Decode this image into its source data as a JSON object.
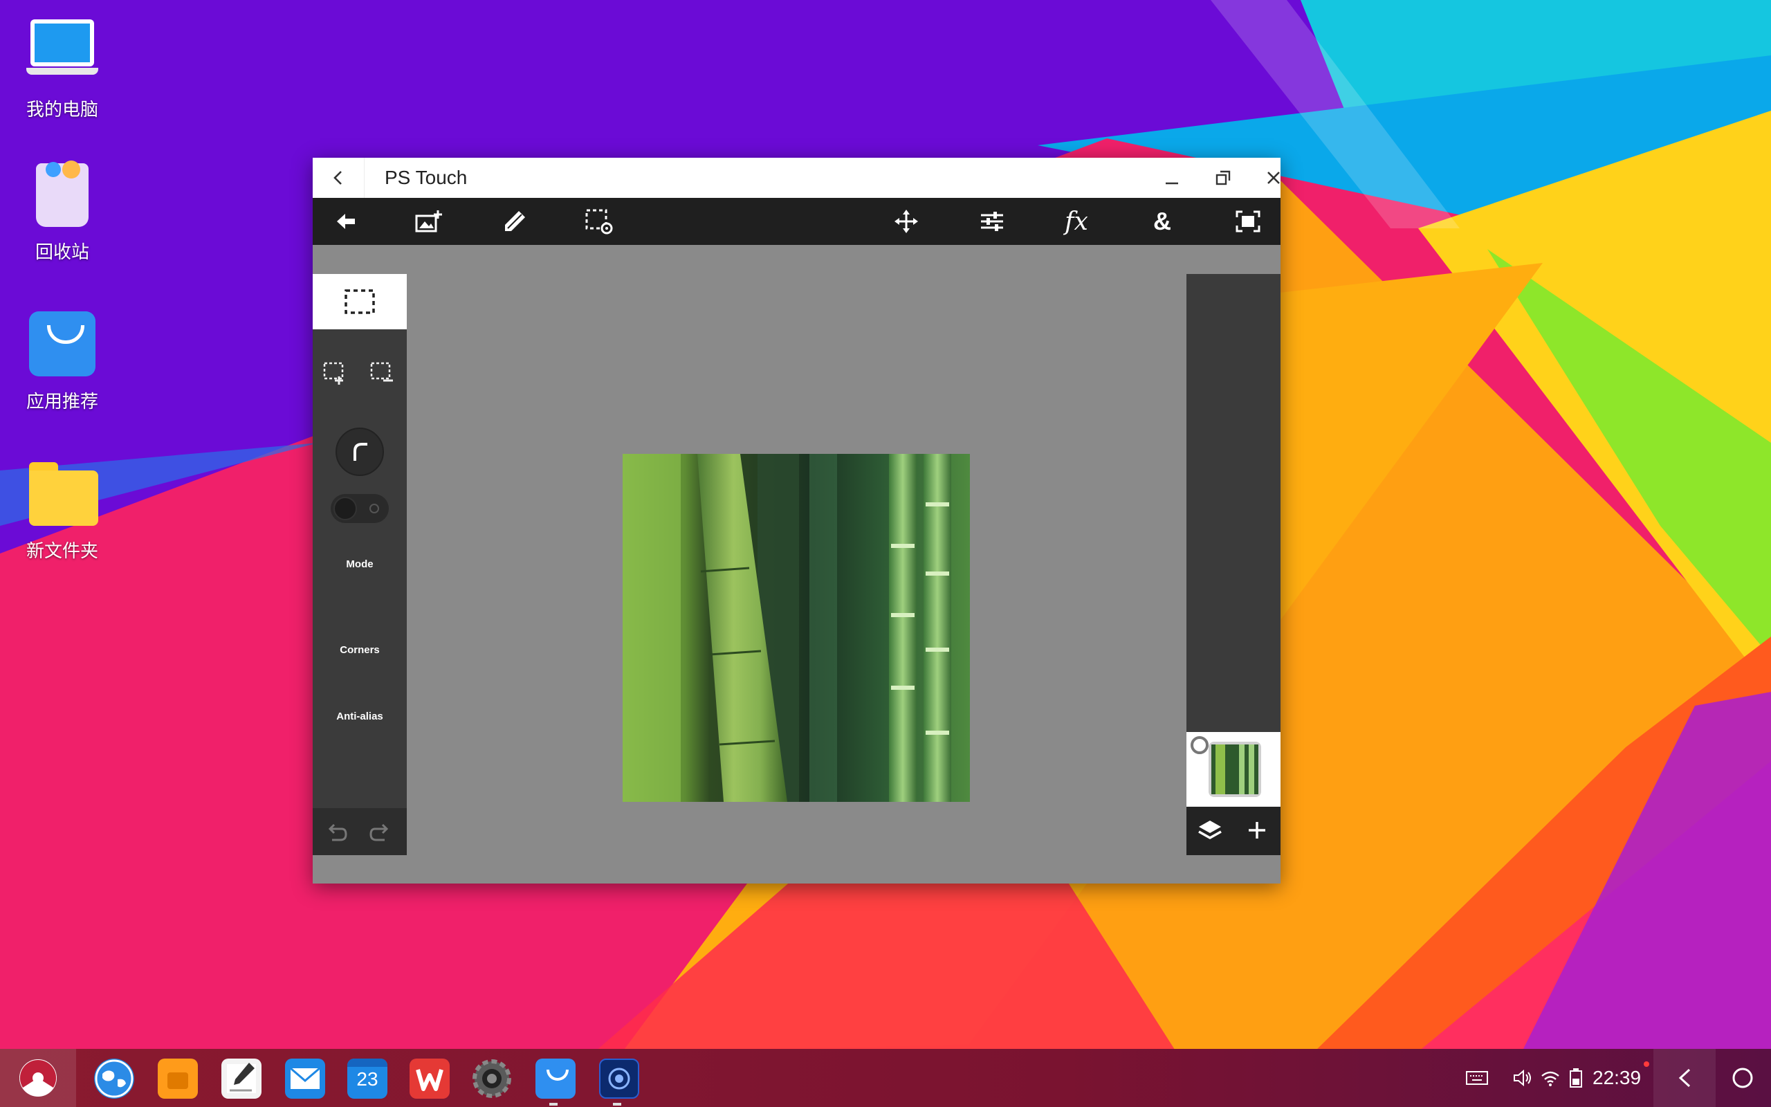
{
  "desktop": {
    "icons": [
      {
        "label": "我的电脑"
      },
      {
        "label": "回收站"
      },
      {
        "label": "应用推荐"
      },
      {
        "label": "新文件夹"
      }
    ]
  },
  "window": {
    "title": "PS Touch",
    "toolbar_icons": [
      "back-arrow-icon",
      "add-image-icon",
      "brush-icon",
      "selection-settings-icon",
      "move-icon",
      "adjustments-icon",
      "fx-icon",
      "ampersand-icon",
      "fit-screen-icon"
    ],
    "fx_label": "fx",
    "amp_label": "&"
  },
  "left_panel": {
    "mode_label": "Mode",
    "corners_label": "Corners",
    "antialias_label": "Anti-alias",
    "antialias_on": false
  },
  "right_panel": {
    "layer_count": 1
  },
  "taskbar": {
    "apps": [
      "browser-icon",
      "files-icon",
      "notes-icon",
      "mail-icon",
      "calendar-icon",
      "wps-icon",
      "settings-icon",
      "app-store-icon",
      "ps-touch-icon"
    ],
    "calendar_day": "23",
    "time": "22:39"
  },
  "colors": {
    "accent_blue": "#1e88e5",
    "toolbar_bg": "#1f1f1f",
    "panel_bg": "#3b3b3b",
    "canvas_bg": "#8a8a8a"
  }
}
